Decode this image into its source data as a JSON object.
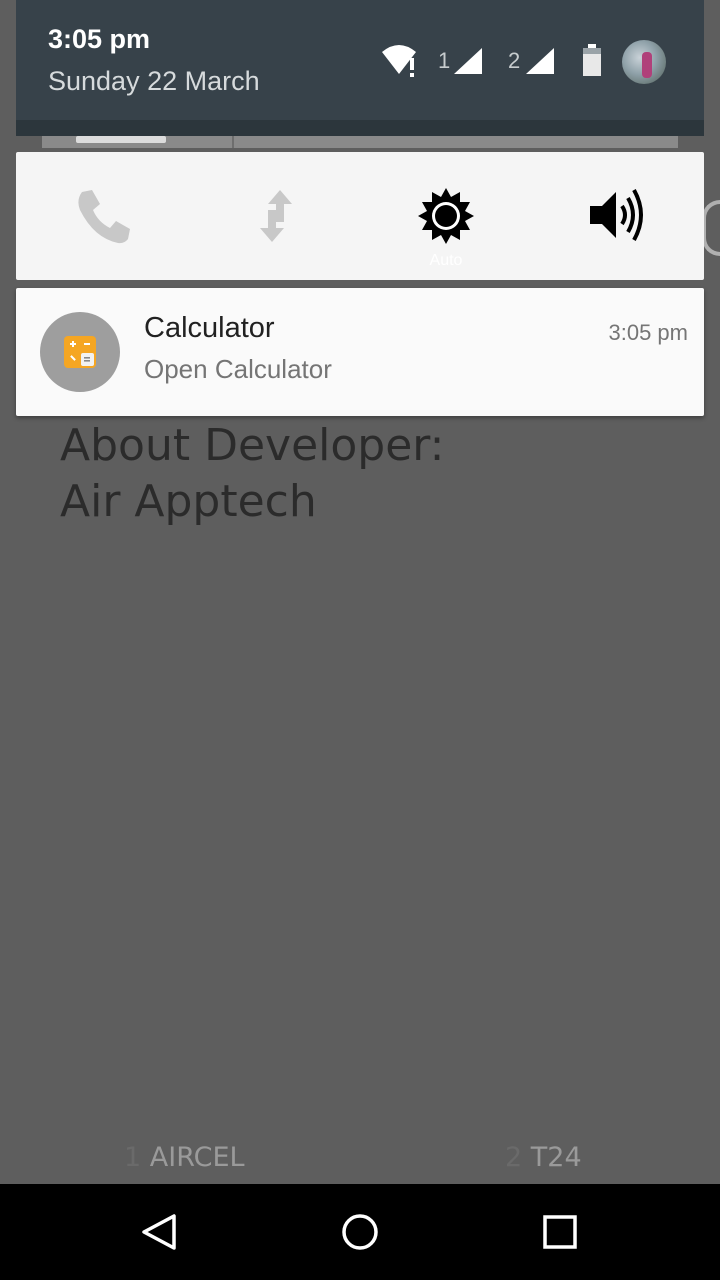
{
  "status": {
    "time": "3:05 pm",
    "date": "Sunday 22 March",
    "sim1_label": "1",
    "sim2_label": "2",
    "icons": [
      "wifi-alert-icon",
      "signal-icon",
      "signal-icon",
      "battery-icon",
      "avatar"
    ]
  },
  "quick_settings": {
    "tiles": [
      {
        "icon": "phone-icon"
      },
      {
        "icon": "data-transfer-icon"
      },
      {
        "icon": "brightness-icon",
        "label": "Auto"
      },
      {
        "icon": "volume-icon"
      }
    ]
  },
  "notification": {
    "app": "Calculator",
    "text": "Open Calculator",
    "time": "3:05 pm",
    "icon": "calculator-icon"
  },
  "background": {
    "about_line1": "About Developer:",
    "about_line2": "Air Apptech",
    "carrier1_slot": "1",
    "carrier1_name": "AIRCEL",
    "carrier2_slot": "2",
    "carrier2_name": "T24"
  },
  "nav": {
    "buttons": [
      "back-icon",
      "home-icon",
      "recents-icon"
    ]
  },
  "colors": {
    "header_bg": "#37424a",
    "card_bg": "#fafafa",
    "scrim": "#5e5e5e"
  }
}
